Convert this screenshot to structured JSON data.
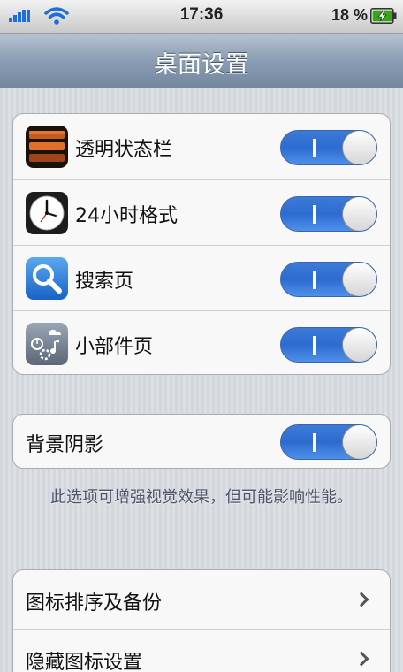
{
  "status_bar": {
    "time": "17:36",
    "battery_percent": "18 %",
    "signal_icon": "cellular-signal-icon",
    "wifi_icon": "wifi-icon",
    "battery_icon": "battery-charging-icon"
  },
  "nav": {
    "title": "桌面设置"
  },
  "groups": [
    {
      "rows": [
        {
          "label": "透明状态栏",
          "icon": "status-bar-app-icon",
          "toggle": "I",
          "on": true
        },
        {
          "label": "24小时格式",
          "icon": "clock-app-icon",
          "toggle": "I",
          "on": true
        },
        {
          "label": "搜索页",
          "icon": "search-app-icon",
          "toggle": "I",
          "on": true
        },
        {
          "label": "小部件页",
          "icon": "widgets-app-icon",
          "toggle": "I",
          "on": true
        }
      ]
    },
    {
      "rows": [
        {
          "label": "背景阴影",
          "toggle": "I",
          "on": true
        }
      ]
    },
    {
      "rows": [
        {
          "label": "图标排序及备份",
          "icon": "chevron-right-icon"
        },
        {
          "label": "隐藏图标设置",
          "icon": "chevron-right-icon"
        }
      ]
    }
  ],
  "footnote": "此选项可增强视觉效果，但可能影响性能。",
  "colors": {
    "toggle_blue": "#2d6bd0",
    "nav_bar": "#8a9db3",
    "footnote_text": "#4c566a"
  }
}
